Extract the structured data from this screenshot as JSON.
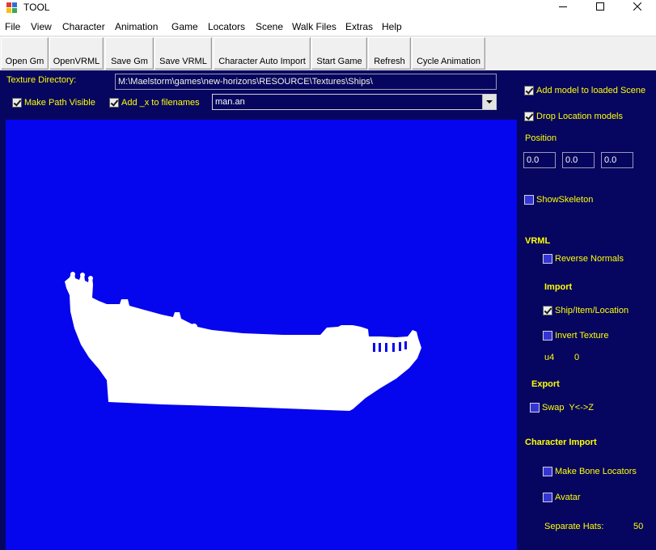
{
  "window": {
    "title": "TOOL",
    "icons": [
      "app-icon",
      "minimize-icon",
      "maximize-icon",
      "close-icon"
    ]
  },
  "menu": {
    "items": [
      "File",
      "View",
      "Character",
      "Animation",
      "Game",
      "Locators",
      "Scene",
      "Walk Files",
      "Extras",
      "Help"
    ]
  },
  "toolbar": {
    "buttons": [
      "Open Gm",
      "OpenVRML",
      "Save Gm",
      "Save VRML",
      "Character Auto Import",
      "Start Game",
      "Refresh",
      "Cycle Animation"
    ]
  },
  "texture": {
    "label": "Texture Directory:",
    "path": "M:\\Maelstorm\\games\\new-horizons\\RESOURCE\\Textures\\Ships\\"
  },
  "options": {
    "make_path_visible": {
      "label": "Make Path Visible",
      "checked": true
    },
    "add_x_to_filenames": {
      "label": "Add _x to filenames",
      "checked": true
    },
    "animation_file": "man.an",
    "dropdown_icon": "dropdown-arrow-icon"
  },
  "scene": {
    "add_model": {
      "label": "Add model to loaded Scene",
      "checked": true
    },
    "drop_location_models": {
      "label": "Drop Location models",
      "checked": true
    },
    "position": {
      "label": "Position",
      "x": "0.0",
      "y": "0.0",
      "z": "0.0"
    },
    "show_skeleton": {
      "label": "ShowSkeleton",
      "checked": false
    }
  },
  "vrml": {
    "heading": "VRML",
    "reverse_normals": {
      "label": "Reverse Normals",
      "checked": false
    },
    "import": {
      "heading": "Import",
      "ship_item_location": {
        "label": "Ship/Item/Location",
        "checked": true
      },
      "invert_texture": {
        "label": "Invert Texture",
        "checked": false
      },
      "u4_label": "u4",
      "u4_value": "0"
    },
    "export": {
      "heading": "Export",
      "swap_y_z": {
        "label": "Swap  Y<->Z",
        "checked": false
      }
    }
  },
  "character_import": {
    "heading": "Character Import",
    "make_bone_locators": {
      "label": "Make Bone Locators",
      "checked": false
    },
    "avatar": {
      "label": "Avatar",
      "checked": false
    },
    "separate_hats": {
      "label": "Separate Hats:",
      "value": "50"
    }
  },
  "colors": {
    "form_bg": "#060660",
    "label": "#ffff00",
    "viewport": "#0505ee",
    "model": "#ffffff"
  }
}
